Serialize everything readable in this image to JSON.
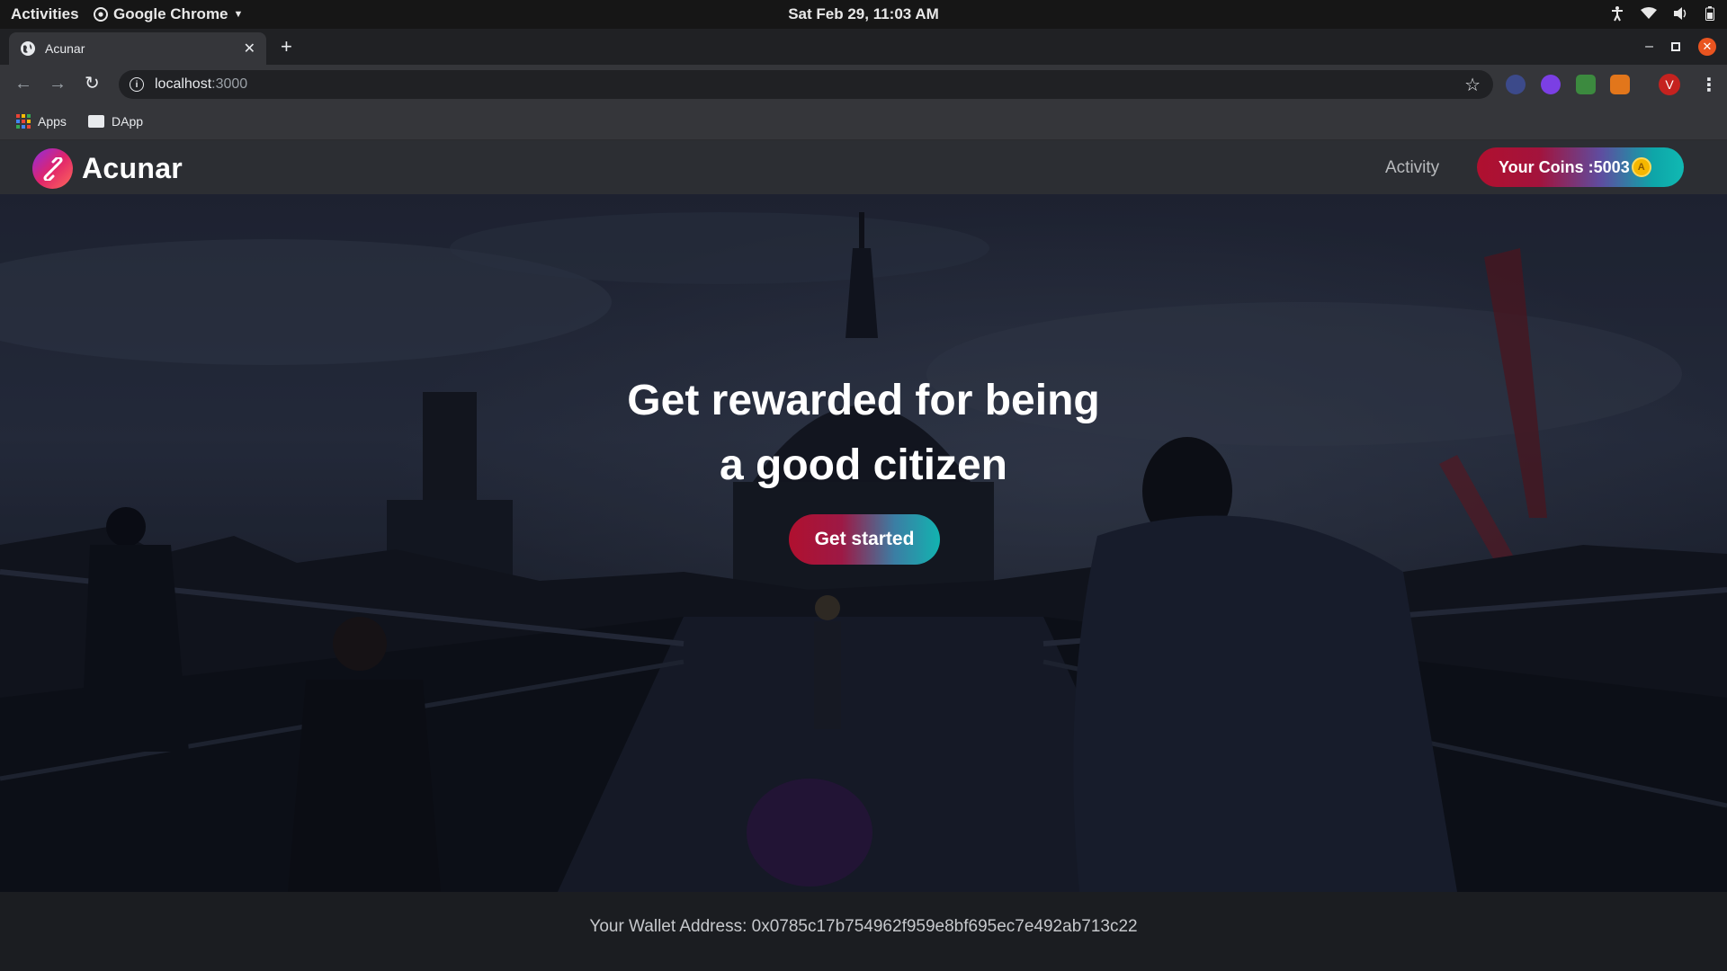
{
  "system": {
    "activities": "Activities",
    "app_menu": "Google Chrome",
    "clock": "Sat Feb 29, 11:03 AM"
  },
  "browser": {
    "tab_title": "Acunar",
    "url_host": "localhost",
    "url_port": ":3000",
    "profile_initial": "V",
    "bookmarks": [
      "Apps",
      "DApp"
    ]
  },
  "site": {
    "brand": "Acunar",
    "nav_activity": "Activity",
    "coins_label": "Your Coins :5003",
    "coin_symbol": "A",
    "hero": {
      "line1": "Get rewarded for being",
      "line2": "a good citizen",
      "cta": "Get started"
    },
    "wallet": "Your Wallet Address: 0x0785c17b754962f959e8bf695ec7e492ab713c22"
  },
  "colors": {
    "accent_red": "#b0102f",
    "accent_teal": "#10b9b3",
    "navbar_bg": "#2c2e33",
    "footer_bg": "#1b1d21"
  }
}
